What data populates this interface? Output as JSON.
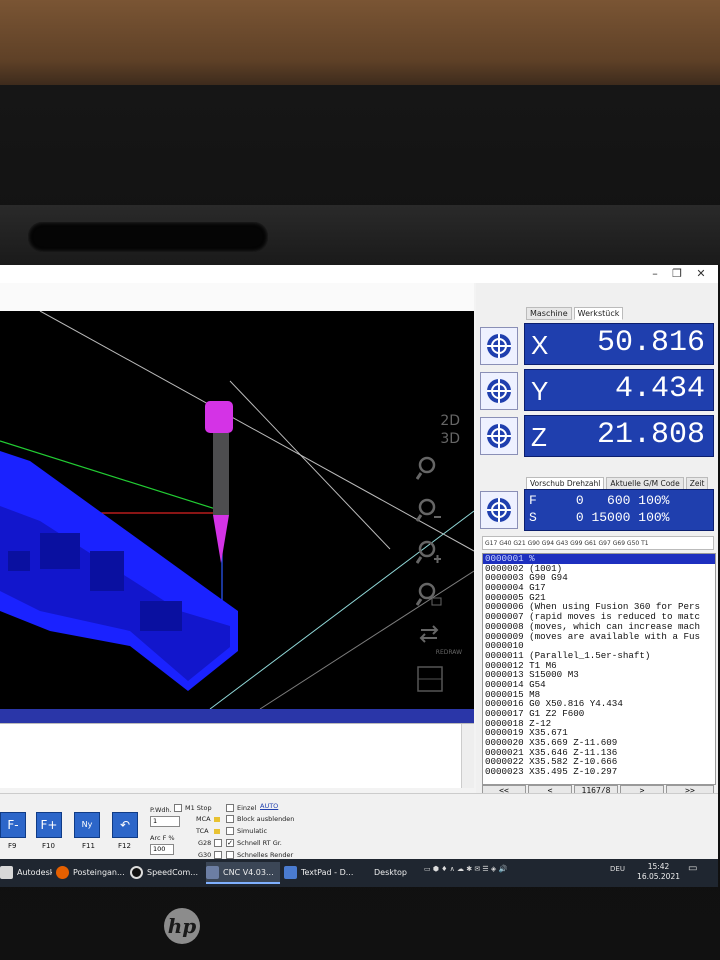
{
  "window": {
    "minimize": "–",
    "maximize": "❐",
    "close": "✕"
  },
  "viewport": {
    "view_2d": "2D",
    "view_3d": "3D",
    "redraw_label": "REDRAW"
  },
  "dro": {
    "tabs": [
      "Maschine",
      "Werkstück"
    ],
    "active_tab": "Werkstück",
    "axes": [
      {
        "letter": "X",
        "value": "50.816"
      },
      {
        "letter": "Y",
        "value": "4.434"
      },
      {
        "letter": "Z",
        "value": "21.808"
      }
    ]
  },
  "feed_panel": {
    "tabs": [
      "Vorschub Drehzahl",
      "Aktuelle G/M Code",
      "Zeit"
    ],
    "f_label": "F",
    "f_current": "0",
    "f_set": "600",
    "f_pct": "100%",
    "s_label": "S",
    "s_current": "0",
    "s_set": "15000",
    "s_pct": "100%"
  },
  "active_gcodes": "G17 G40 G21 G90 G94 G43 G99 G61 G97 G69 G50 T1",
  "program": {
    "lines": [
      "0000001 %",
      "0000002 (1001)",
      "0000003 G90 G94",
      "0000004 G17",
      "0000005 G21",
      "0000006 (When using Fusion 360 for Pers",
      "0000007 (rapid moves is reduced to matc",
      "0000008 (moves, which can increase mach",
      "0000009 (moves are available with a Fus",
      "0000010",
      "0000011 (Parallel_1.5er-shaft)",
      "0000012 T1 M6",
      "0000013 S15000 M3",
      "0000014 G54",
      "0000015 M8",
      "0000016 G0 X50.816 Y4.434",
      "0000017 G1 Z2 F600",
      "0000018 Z-12",
      "0000019 X35.671",
      "0000020 X35.669 Z-11.609",
      "0000021 X35.646 Z-11.136",
      "0000022 X35.582 Z-10.666",
      "0000023 X35.495 Z-10.297"
    ],
    "selected_index": 0,
    "nav": {
      "first": "<<",
      "prev": "<",
      "counter": "1167/8",
      "next": ">",
      "last": ">>"
    }
  },
  "function_keys": [
    {
      "icon": "F-",
      "label": "F9"
    },
    {
      "icon": "F+",
      "label": "F10"
    },
    {
      "icon": "Ny",
      "label": "F11"
    },
    {
      "icon": "↶",
      "label": "F12"
    }
  ],
  "options": {
    "pwdh_label": "P.Wdh.",
    "pwdh_value": "1",
    "arc_label": "Arc F %",
    "arc_value": "100",
    "m1_stop": "M1 Stop",
    "mca": "MCA",
    "tca": "TCA",
    "g28": "G28",
    "g30": "G30",
    "einzel": "Einzel",
    "auto": "AUTO",
    "block_ausblenden": "Block ausblenden",
    "simulatic": "Simulatic",
    "schnell_rt": "Schnell RT Gr.",
    "schnelles_render": "Schnelles Render"
  },
  "taskbar": {
    "items": [
      "Autodesk F...",
      "Posteingan...",
      "SpeedCom...",
      "CNC V4.03...",
      "TextPad - D..."
    ],
    "active_item": "CNC V4.03...",
    "desktop": "Desktop",
    "lang": "DEU",
    "time": "15:42",
    "date": "16.05.2021"
  },
  "brand": {
    "logo_text": "hp"
  },
  "colors": {
    "dro_blue": "#1f3fae",
    "part_blue": "#1a22ff",
    "tool_magenta": "#d433e6",
    "taskbar": "#1f2630"
  }
}
